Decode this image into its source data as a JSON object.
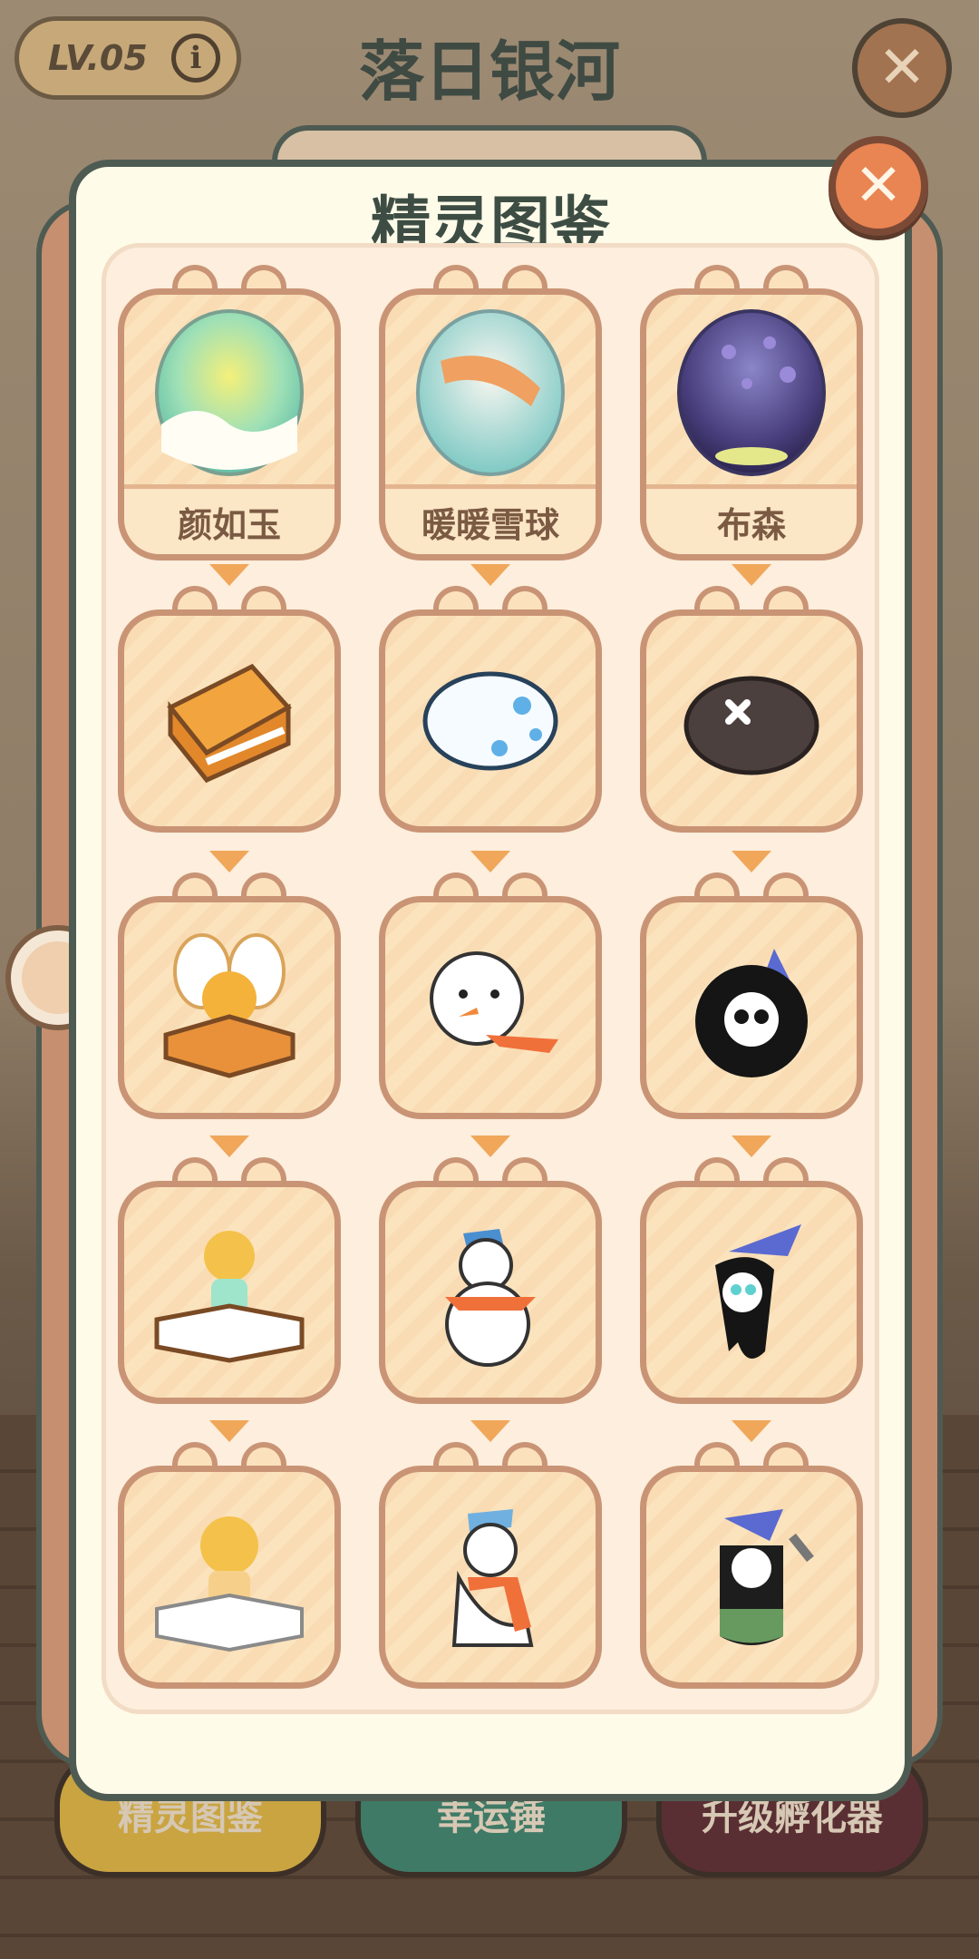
{
  "header": {
    "level": "LV.05",
    "info_icon": "i",
    "title": "落日银河",
    "close_icon": "close-icon"
  },
  "modal": {
    "title": "精灵图鉴",
    "close_icon": "close-icon"
  },
  "eggs": [
    {
      "label": "颜如玉",
      "icon": "jade-egg-icon"
    },
    {
      "label": "暖暖雪球",
      "icon": "snowball-egg-icon"
    },
    {
      "label": "布森",
      "icon": "galaxy-egg-icon"
    }
  ],
  "rows": [
    [
      "book-icon",
      "white-egg-icon",
      "dark-stone-icon"
    ],
    [
      "fairy-book-icon",
      "snowman-head-icon",
      "skull-ghost-icon"
    ],
    [
      "elf-fairy-icon",
      "snowman-icon",
      "wizard-ghost-icon"
    ],
    [
      "golden-fairy-icon",
      "snowman-scarf-icon",
      "reaper-ghost-icon"
    ]
  ],
  "bottom_buttons": [
    "精灵图鉴",
    "幸运锤",
    "升级孵化器"
  ],
  "colors": {
    "accent_orange": "#e98552",
    "card_border": "#c99475",
    "modal_border": "#4e5b52"
  }
}
